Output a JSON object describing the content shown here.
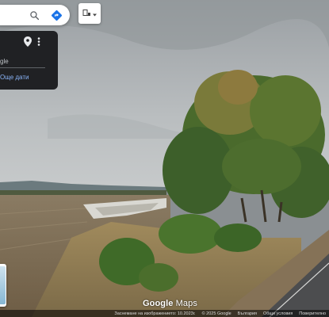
{
  "searchbox": {
    "search_icon": "search-icon",
    "directions_icon": "directions-icon"
  },
  "layers_button": {
    "icon": "layers-icon"
  },
  "info_card": {
    "owner": "gle",
    "dates_link": "Още дати",
    "pin_icon": "location-pin-icon",
    "more_icon": "more-vert-icon"
  },
  "watermark": {
    "brand": "Google",
    "product": "Maps"
  },
  "footer": {
    "capture_date": "Заснемане на изображението: 10.2023г.",
    "copyright": "© 2025 Google",
    "country": "България",
    "terms": "Общи условия",
    "privacy": "Поверително"
  },
  "colors": {
    "directions": "#1a73e8",
    "link": "#8ab4f8",
    "card": "#202124"
  }
}
